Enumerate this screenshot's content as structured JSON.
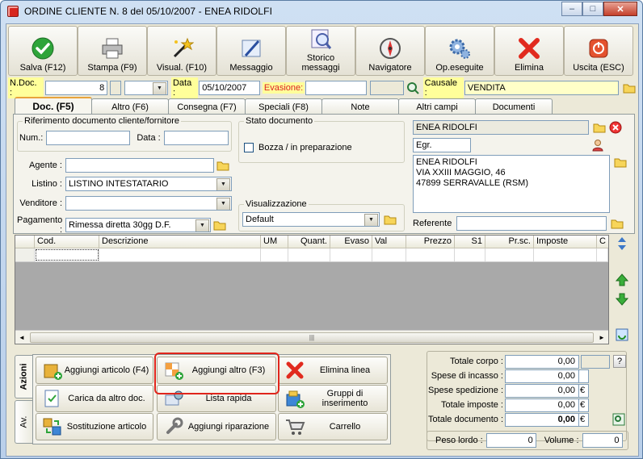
{
  "window": {
    "title": "ORDINE CLIENTE N. 8  del 05/10/2007  - ENEA RIDOLFI",
    "controls": {
      "minimize": "–",
      "maximize": "□",
      "close": "✕"
    }
  },
  "toolbar": {
    "buttons": [
      {
        "label": "Salva (F12)",
        "icon": "checkmark-icon"
      },
      {
        "label": "Stampa (F9)",
        "icon": "printer-icon"
      },
      {
        "label": "Visual. (F10)",
        "icon": "magic-wand-icon"
      },
      {
        "label": "Messaggio",
        "icon": "message-pen-icon"
      },
      {
        "label": "Storico messaggi",
        "icon": "message-history-icon"
      },
      {
        "label": "Navigatore",
        "icon": "compass-icon"
      },
      {
        "label": "Op.eseguite",
        "icon": "gears-icon"
      },
      {
        "label": "Elimina",
        "icon": "delete-x-icon"
      },
      {
        "label": "Uscita (ESC)",
        "icon": "exit-icon"
      }
    ]
  },
  "header": {
    "ndoc_label": "N.Doc. :",
    "ndoc_value": "8",
    "data_label": "Data :",
    "data_value": "05/10/2007",
    "evasione_label": "Evasione:",
    "evasione_value": "",
    "causale_label": "Causale :",
    "causale_value": "VENDITA"
  },
  "tabs": [
    "Doc. (F5)",
    "Altro (F6)",
    "Consegna (F7)",
    "Speciali (F8)",
    "Note",
    "Altri campi",
    "Documenti"
  ],
  "doc": {
    "rif_group": "Riferimento documento cliente/fornitore",
    "num_label": "Num.:",
    "num_value": "",
    "data_label": "Data :",
    "data_value": "",
    "stato_group": "Stato documento",
    "bozza_label": "Bozza / in preparazione",
    "agente_label": "Agente :",
    "agente_value": "",
    "listino_label": "Listino :",
    "listino_value": "LISTINO INTESTATARIO",
    "venditore_label": "Venditore :",
    "venditore_value": "",
    "pagamento_label": "Pagamento :",
    "pagamento_value": "Rimessa diretta 30gg D.F.",
    "visual_group": "Visualizzazione",
    "visual_value": "Default",
    "client_name": "ENEA RIDOLFI",
    "client_title": "Egr.",
    "address_lines": [
      "ENEA RIDOLFI",
      "VIA XXIII MAGGIO, 46",
      "47899 SERRAVALLE (RSM)"
    ],
    "referente_label": "Referente",
    "referente_value": ""
  },
  "grid": {
    "columns": [
      "Cod.",
      "Descrizione",
      "UM",
      "Quant.",
      "Evaso",
      "Val",
      "Prezzo",
      "S1",
      "Pr.sc.",
      "Imposte",
      "C"
    ]
  },
  "actions": {
    "vtabs": [
      "Azioni",
      "Av."
    ],
    "buttons": [
      {
        "label": "Aggiungi articolo (F4)",
        "icon": "add-article-icon"
      },
      {
        "label": "Aggiungi altro (F3)",
        "icon": "add-other-icon"
      },
      {
        "label": "Elimina linea",
        "icon": "delete-line-icon"
      },
      {
        "label": "Carica da altro doc.",
        "icon": "load-doc-icon"
      },
      {
        "label": "Lista rapida",
        "icon": "quick-list-icon"
      },
      {
        "label": "Gruppi di inserimento",
        "icon": "insert-groups-icon"
      },
      {
        "label": "Sostituzione articolo",
        "icon": "replace-article-icon"
      },
      {
        "label": "Aggiungi riparazione",
        "icon": "wrench-icon"
      },
      {
        "label": "Carrello",
        "icon": "cart-icon"
      }
    ]
  },
  "totals": {
    "rows": [
      {
        "label": "Totale corpo :",
        "value": "0,00",
        "unit": ""
      },
      {
        "label": "Spese di incasso :",
        "value": "0,00",
        "unit": ""
      },
      {
        "label": "Spese spedizione :",
        "value": "0,00",
        "unit": "€"
      },
      {
        "label": "Totale imposte :",
        "value": "0,00",
        "unit": "€"
      },
      {
        "label": "Totale documento :",
        "value": "0,00",
        "unit": "€"
      }
    ],
    "help": "?",
    "peso_label": "Peso lordo :",
    "peso_value": "0",
    "volume_label": "Volume :",
    "volume_value": "0"
  },
  "colors": {
    "accent_yellow": "#ffff9a",
    "highlight_red": "#e0251c",
    "face": "#ece9d8"
  }
}
